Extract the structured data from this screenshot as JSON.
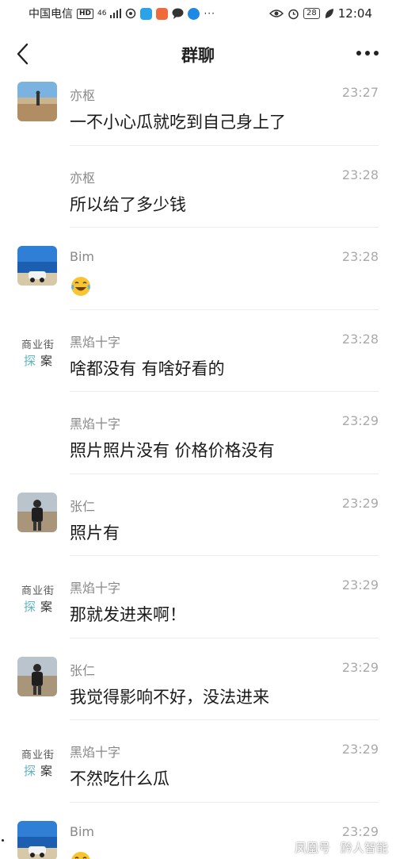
{
  "status_bar": {
    "carrier": "中国电信",
    "hd_badge": "HD",
    "network": "46",
    "battery": "28",
    "time": "12:04",
    "more_dots": "···"
  },
  "header": {
    "title": "群聊"
  },
  "messages": [
    {
      "sender": "亦枢",
      "time": "23:27",
      "text": "一不小心瓜就吃到自己身上了",
      "avatar": "desert-photo",
      "show_avatar": true
    },
    {
      "sender": "亦枢",
      "time": "23:28",
      "text": "所以给了多少钱",
      "avatar": "",
      "show_avatar": false
    },
    {
      "sender": "Bim",
      "time": "23:28",
      "text": "",
      "emoji": "laughing-tears-emoji",
      "avatar": "lake-car-photo",
      "show_avatar": true
    },
    {
      "sender": "黑焰十字",
      "time": "23:28",
      "text": "啥都没有 有啥好看的",
      "avatar": "text-logo",
      "show_avatar": true
    },
    {
      "sender": "黑焰十字",
      "time": "23:29",
      "text": "照片照片没有 价格价格没有",
      "avatar": "",
      "show_avatar": false
    },
    {
      "sender": "张仁",
      "time": "23:29",
      "text": "照片有",
      "avatar": "person-photo",
      "show_avatar": true
    },
    {
      "sender": "黑焰十字",
      "time": "23:29",
      "text": "那就发进来啊！",
      "avatar": "text-logo",
      "show_avatar": true
    },
    {
      "sender": "张仁",
      "time": "23:29",
      "text": "我觉得影响不好，没法进来",
      "avatar": "person-photo",
      "show_avatar": true
    },
    {
      "sender": "黑焰十字",
      "time": "23:29",
      "text": "不然吃什么瓜",
      "avatar": "text-logo",
      "show_avatar": true
    },
    {
      "sender": "Bim",
      "time": "23:29",
      "text": "",
      "emoji": "laughing-tears-emoji",
      "avatar": "lake-car-photo",
      "show_avatar": true
    }
  ],
  "text_logo": {
    "line1": "商业街",
    "line2a": "探",
    "line2b": "案"
  },
  "watermark": {
    "left": "凤凰号",
    "right": "黔人智能"
  },
  "colors": {
    "accent_teal": "#5fb4c0",
    "background": "#ffffff",
    "meta_gray": "#aaaaaa"
  }
}
